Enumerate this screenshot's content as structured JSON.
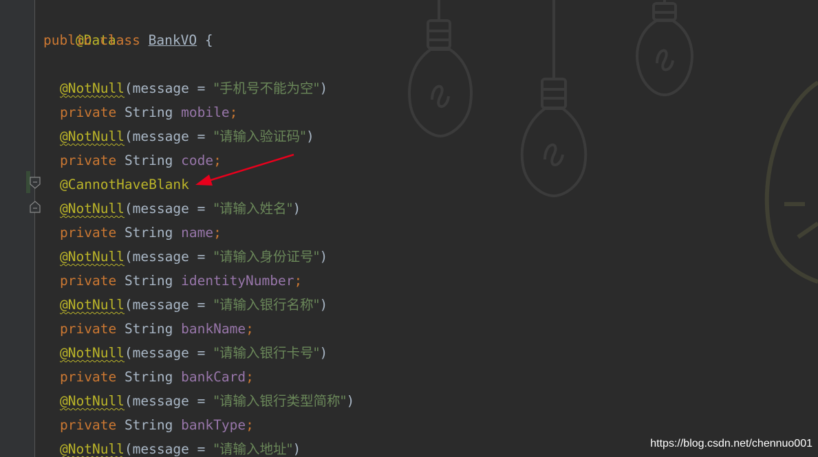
{
  "code": {
    "annotation_data": "@Data",
    "class_decl": {
      "modifier": "public",
      "keyword": "class",
      "name": "BankVO",
      "brace": "{"
    },
    "annotation_notnull": "@NotNull",
    "annotation_cannot_have_blank": "@CannotHaveBlank",
    "param_prefix": "(message = ",
    "param_suffix": ")",
    "field_modifier": "private",
    "field_type": "String",
    "semicolon": ";",
    "messages": {
      "mobile": "\"手机号不能为空\"",
      "code": "\"请输入验证码\"",
      "name": "\"请输入姓名\"",
      "identity": "\"请输入身份证号\"",
      "bank_name": "\"请输入银行名称\"",
      "bank_card": "\"请输入银行卡号\"",
      "bank_type": "\"请输入银行类型简称\"",
      "address": "\"请输入地址\""
    },
    "fields": {
      "mobile": "mobile",
      "code": "code",
      "name": "name",
      "identity": "identityNumber",
      "bank_name": "bankName",
      "bank_card": "bankCard",
      "bank_type": "bankType"
    }
  },
  "watermark": "https://blog.csdn.net/chennuo001",
  "colors": {
    "background": "#2b2b2b",
    "keyword": "#cc7832",
    "annotation": "#bbb529",
    "string": "#6a8759",
    "field": "#9876aa",
    "text": "#a9b7c6",
    "arrow": "#e8001c"
  },
  "icons": [
    "fold-start-icon",
    "fold-end-icon",
    "lightbulb-decoration-icon"
  ]
}
